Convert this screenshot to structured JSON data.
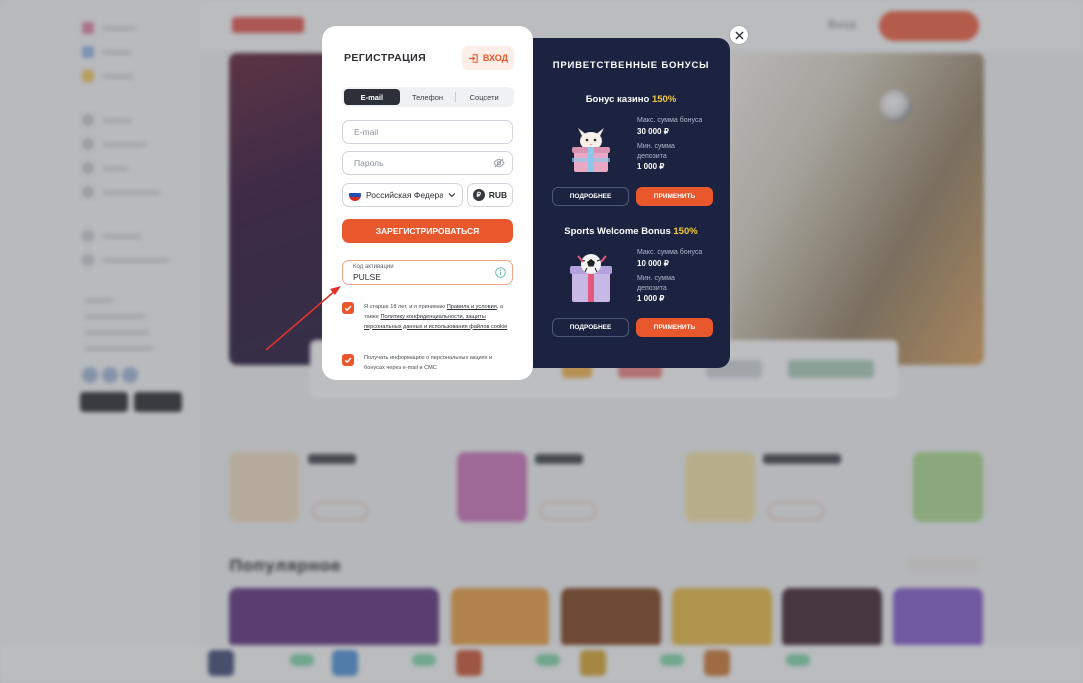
{
  "registration": {
    "title": "РЕГИСТРАЦИЯ",
    "login_label": "ВХОД",
    "tabs": [
      "E-mail",
      "Телефон",
      "Соцсети"
    ],
    "active_tab": "E-mail",
    "email_placeholder": "E-mail",
    "password_placeholder": "Пароль",
    "country": "Российская Федерация",
    "currency": "RUB",
    "currency_symbol": "₽",
    "register_label": "ЗАРЕГИСТРИРОВАТЬСЯ",
    "promo_label": "Код активации",
    "promo_value": "PULSE",
    "agree_prefix": "Я старше 18 лет, и я принимаю ",
    "agree_rules": "Правила и условия",
    "agree_mid": ", а также ",
    "agree_policy": "Политику конфиденциальности, защиты персональных данных и использования файлов cookie",
    "marketing": "Получать информацию о персональных акциях и бонусах через e-mail и СМС"
  },
  "bonuses": {
    "title": "ПРИВЕТСТВЕННЫЕ БОНУСЫ",
    "offers": [
      {
        "name": "Бонус казино",
        "percent": "150%",
        "max_label": "Макс. сумма бонуса",
        "max_value": "30 000 ₽",
        "min_label": "Мин. сумма депозита",
        "min_value": "1 000 ₽",
        "more_label": "ПОДРОБНЕЕ",
        "apply_label": "ПРИМЕНИТЬ",
        "icon": "gift-box-fox-icon"
      },
      {
        "name": "Sports Welcome Bonus",
        "percent": "150%",
        "max_label": "Макс. сумма бонуса",
        "max_value": "10 000 ₽",
        "min_label": "Мин. сумма депозита",
        "min_value": "1 000 ₽",
        "more_label": "ПОДРОБНЕЕ",
        "apply_label": "ПРИМЕНИТЬ",
        "icon": "gift-box-football-icon"
      }
    ]
  },
  "background": {
    "login_link": "Вход",
    "popular_heading": "Популярное"
  },
  "colors": {
    "accent": "#e9582d",
    "bonus_panel": "#1b2340",
    "highlight": "#f3c93c"
  }
}
